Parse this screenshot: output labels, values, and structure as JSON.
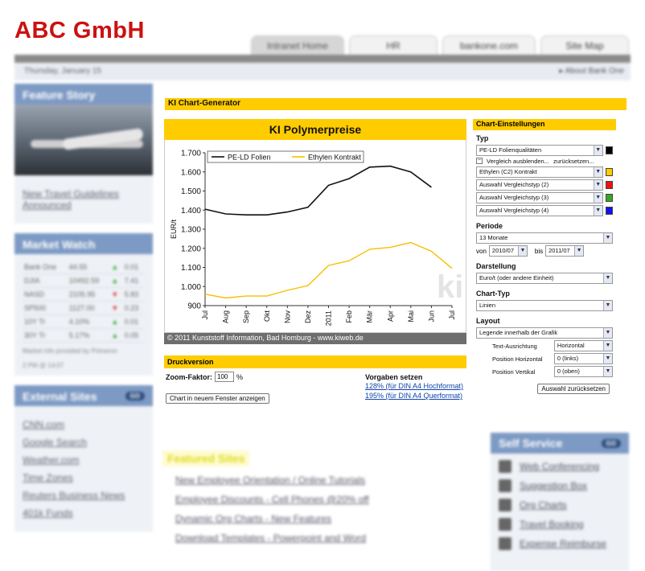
{
  "portal": {
    "logo": "ABC GmbH",
    "tabs": [
      "Intranet Home",
      "HR",
      "bankone.com",
      "Site Map"
    ],
    "date": "Thursday, January 15",
    "about": "About Bank One",
    "feature_story": {
      "heading": "Feature Story",
      "link": "New Travel Guidelines Announced"
    },
    "market_watch": {
      "heading": "Market Watch",
      "rows": [
        {
          "name": "Bank One",
          "value": "44.55",
          "dir": "▲",
          "change": "0.01"
        },
        {
          "name": "DJIA",
          "value": "10492.59",
          "dir": "▲",
          "change": "7.41"
        },
        {
          "name": "NASD",
          "value": "2105.95",
          "dir": "▼",
          "change": "5.83"
        },
        {
          "name": "SP500",
          "value": "1127.00",
          "dir": "▼",
          "change": "0.23"
        },
        {
          "name": "10Y Tr",
          "value": "4.10%",
          "dir": "▲",
          "change": "0.01"
        },
        {
          "name": "30Y Tr",
          "value": "5.17%",
          "dir": "▲",
          "change": "0.05"
        }
      ],
      "note": "Market info provided by Primeron",
      "time": "2 PM @ 14:07"
    },
    "external_sites": {
      "heading": "External Sites",
      "go": "GO",
      "links": [
        "CNN.com",
        "Google Search",
        "Weather.com",
        "Time Zones",
        "Reuters Business News",
        "401k Funds"
      ]
    },
    "featured_sites": {
      "heading": "Featured Sites",
      "links": [
        "New Employee Orientation / Online Tutorials",
        "Employee Discounts - Cell Phones @20% off",
        "Dynamic Org Charts - New Features",
        "Download Templates - Powerpoint and Word"
      ]
    },
    "self_service": {
      "heading": "Self Service",
      "go": "GO",
      "items": [
        "Web Conferencing",
        "Suggestion Box",
        "Org Charts",
        "Travel Booking",
        "Expense Reimburse"
      ]
    }
  },
  "generator": {
    "title": "KI Chart-Generator",
    "chart_title": "KI Polymerpreise",
    "copyright": "© 2011 Kunststoff Information, Bad Homburg - www.kiweb.de",
    "druck": {
      "heading": "Druckversion",
      "zoom_label": "Zoom-Faktor:",
      "zoom_value": "100",
      "zoom_unit": "%",
      "open_button": "Chart in neuem Fenster anzeigen",
      "presets_label": "Vorgaben setzen",
      "preset1": "128% (für DIN A4 Hochformat)",
      "preset2": "195% (für DIN A4 Querformat)"
    },
    "settings": {
      "heading": "Chart-Einstellungen",
      "typ_label": "Typ",
      "typ_value": "PE-LD Folienqualitäten",
      "hide_compare": "Vergleich ausblenden...",
      "reset_link": "zurücksetzen...",
      "compare": [
        {
          "value": "Ethylen (C2) Kontrakt",
          "color": "#ffcc00"
        },
        {
          "value": "Auswahl Vergleichstyp (2)",
          "color": "#ee1111"
        },
        {
          "value": "Auswahl Vergleichstyp (3)",
          "color": "#33aa22"
        },
        {
          "value": "Auswahl Vergleichstyp (4)",
          "color": "#1111ee"
        }
      ],
      "main_color": "#000000",
      "periode_label": "Periode",
      "periode_value": "13 Monate",
      "von_label": "von",
      "von_value": "2010/07",
      "bis_label": "bis",
      "bis_value": "2011/07",
      "darstellung_label": "Darstellung",
      "darstellung_value": "Euro/t (oder andere Einheit)",
      "charttyp_label": "Chart-Typ",
      "charttyp_value": "Linien",
      "layout_label": "Layout",
      "layout_value": "Legende innerhalb der Grafik",
      "textausrichtung_label": "Text-Ausrichtung",
      "textausrichtung_value": "Horizontal",
      "pos_h_label": "Position Horizontal",
      "pos_h_value": "0 (links)",
      "pos_v_label": "Position Vertikal",
      "pos_v_value": "0 (oben)",
      "reset_button": "Auswahl zurücksetzen"
    }
  },
  "chart_data": {
    "type": "line",
    "categories": [
      "Jul",
      "Aug",
      "Sep",
      "Okt",
      "Nov",
      "Dez",
      "2011",
      "Feb",
      "Mär",
      "Apr",
      "Mai",
      "Jun",
      "Jul"
    ],
    "ylabel": "EUR/t",
    "ylim": [
      900,
      1700
    ],
    "yticks": [
      "900",
      "1.000",
      "1.100",
      "1.200",
      "1.300",
      "1.400",
      "1.500",
      "1.600",
      "1.700"
    ],
    "series": [
      {
        "name": "PE-LD Folien",
        "color": "#111111",
        "values": [
          1405,
          1380,
          1375,
          1375,
          1390,
          1415,
          1530,
          1565,
          1625,
          1630,
          1600,
          1520,
          null
        ]
      },
      {
        "name": "Ethylen Kontrakt",
        "color": "#f5c000",
        "values": [
          960,
          940,
          950,
          950,
          980,
          1005,
          1110,
          1135,
          1195,
          1205,
          1230,
          1185,
          1095
        ]
      }
    ],
    "legend": "top-left",
    "grid": false
  }
}
